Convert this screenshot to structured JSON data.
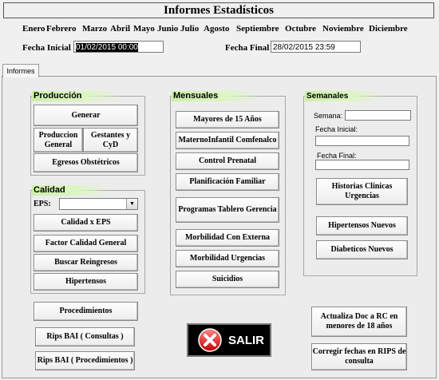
{
  "title": "Informes Estadísticos",
  "months": [
    "Enero",
    "Febrero",
    "Marzo",
    "Abril",
    "Mayo",
    "Junio",
    "Julio",
    "Agosto",
    "Septiembre",
    "Octubre",
    "Noviembre",
    "Diciembre"
  ],
  "dates": {
    "start_label": "Fecha Inicial",
    "start_value": "01/02/2015 00:00",
    "end_label": "Fecha Final",
    "end_value": "28/02/2015 23:59"
  },
  "tab": "Informes",
  "produccion": {
    "header": "Producción",
    "generar": "Generar",
    "produccion_general": "Produccion General",
    "gestantes": "Gestantes y CyD",
    "egresos": "Egresos Obstétricos"
  },
  "calidad": {
    "header": "Calidad",
    "eps_label": "EPS:",
    "eps_value": "",
    "buttons": [
      "Calidad x EPS",
      "Factor Calidad General",
      "Buscar Reingresos",
      "Hipertensos"
    ]
  },
  "mensuales": {
    "header": "Mensuales",
    "buttons": [
      "Mayores de 15 Años",
      "MaternoInfantil Comfenalco",
      "Control Prenatal",
      "Planificación Familiar",
      "Programas Tablero Gerencia",
      "Morbilidad Con Externa",
      "Morbilidad Urgencias",
      "Suicidios"
    ]
  },
  "semanales": {
    "header": "Semanales",
    "semana_label": "Semana:",
    "fecha_inicial_label": "Fecha Inicial:",
    "fecha_final_label": "Fecha Final:",
    "buttons": [
      "Historias Clinicas Urgencias",
      "Hipertensos Nuevos",
      "Diabeticos Nuevos"
    ]
  },
  "bottom": {
    "procedimientos": "Procedimientos",
    "rips_consultas": "Rips BAI ( Consultas )",
    "rips_procedimientos": "Rips BAI ( Procedimientos )",
    "salir": "SALIR",
    "actualiza": "Actualiza Doc a RC en menores de 18 años",
    "corregir": "Corregir fechas en RIPS de consulta"
  },
  "icons": {
    "salir": "close-x-icon",
    "eps_dropdown": "chevron-down-icon"
  }
}
